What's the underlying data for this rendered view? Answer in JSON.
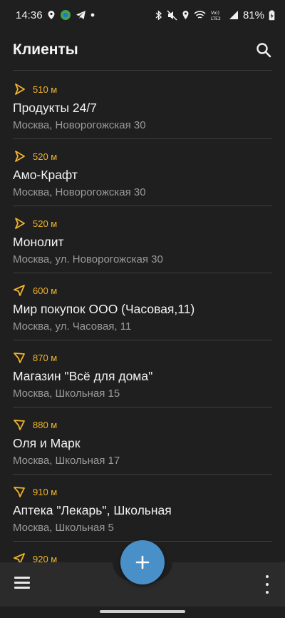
{
  "status": {
    "time": "14:36",
    "battery": "81%",
    "network_label": "Vo)) LTE2"
  },
  "appbar": {
    "title": "Клиенты",
    "search_icon": "search-icon"
  },
  "colors": {
    "accent": "#f0b429",
    "fab": "#4a90c8",
    "background": "#1f1f1f",
    "bottom_bar": "#2b2b2b"
  },
  "clients": [
    {
      "distance": "510 м",
      "name": "Продукты 24/7",
      "address": "Москва, Новорогожская 30",
      "arrow": "navigation-arrow-icon"
    },
    {
      "distance": "520 м",
      "name": "Амо-Крафт",
      "address": "Москва, Новорогожская 30",
      "arrow": "navigation-arrow-icon"
    },
    {
      "distance": "520 м",
      "name": "Монолит",
      "address": "Москва, ул. Новорогожская 30",
      "arrow": "navigation-arrow-icon"
    },
    {
      "distance": "600 м",
      "name": "Мир покупок ООО (Часовая,11)",
      "address": "Москва, ул. Часовая, 11",
      "arrow": "navigation-arrow-icon"
    },
    {
      "distance": "870 м",
      "name": "Магазин \"Всё для дома\"",
      "address": "Москва, Школьная 15",
      "arrow": "navigation-arrow-icon"
    },
    {
      "distance": "880 м",
      "name": "Оля и Марк",
      "address": "Москва, Школьная 17",
      "arrow": "navigation-arrow-icon"
    },
    {
      "distance": "910 м",
      "name": "Аптека \"Лекарь\", Школьная",
      "address": "Москва, Школьная 5",
      "arrow": "navigation-arrow-icon"
    },
    {
      "distance": "920 м",
      "name": "",
      "address": "",
      "arrow": "navigation-arrow-icon"
    }
  ],
  "bottom": {
    "menu_icon": "hamburger-menu-icon",
    "add_icon": "plus-icon",
    "more_icon": "more-vertical-icon"
  }
}
